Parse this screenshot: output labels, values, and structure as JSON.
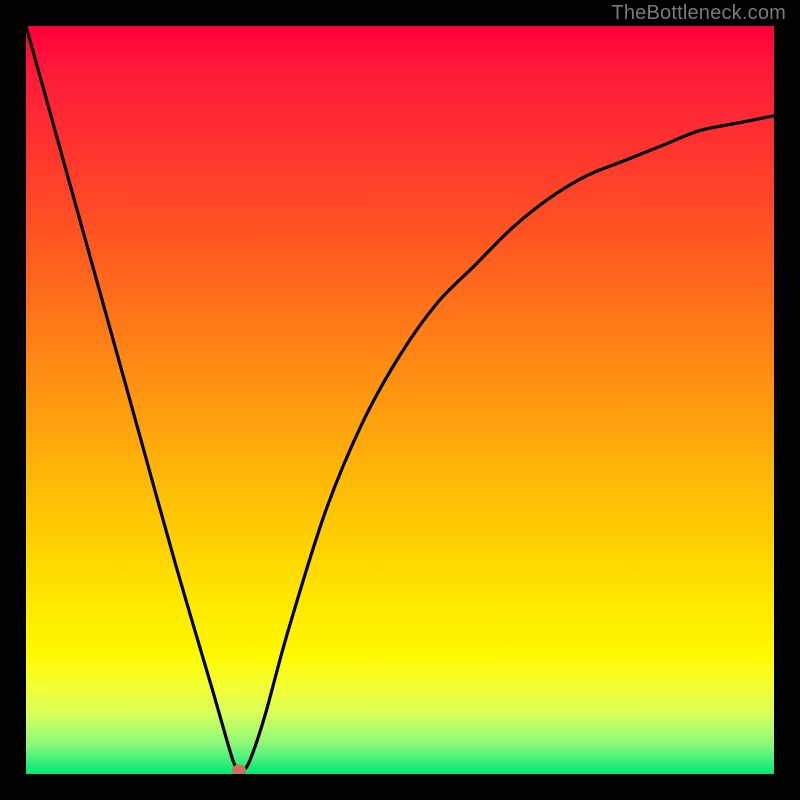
{
  "watermark": "TheBottleneck.com",
  "chart_data": {
    "type": "line",
    "title": "",
    "xlabel": "",
    "ylabel": "",
    "xlim": [
      0,
      100
    ],
    "ylim": [
      0,
      100
    ],
    "grid": false,
    "legend": false,
    "series": [
      {
        "name": "bottleneck-curve",
        "x": [
          0,
          5,
          10,
          15,
          20,
          25,
          27,
          28,
          29,
          30,
          32,
          35,
          40,
          45,
          50,
          55,
          60,
          65,
          70,
          75,
          80,
          85,
          90,
          95,
          100
        ],
        "y": [
          100,
          82,
          64,
          46,
          28,
          11,
          4,
          1,
          0.5,
          2,
          8,
          19,
          35,
          47,
          56,
          63,
          68,
          73,
          77,
          80,
          82,
          84,
          86,
          87,
          88
        ]
      }
    ],
    "annotations": [
      {
        "name": "optimal-point",
        "type": "marker",
        "x": 28.5,
        "y": 0.5,
        "color": "#d86a5a"
      }
    ],
    "background": {
      "type": "vertical-gradient",
      "stops": [
        {
          "pos": 0.0,
          "color": "#ff003a"
        },
        {
          "pos": 0.5,
          "color": "#ff9810"
        },
        {
          "pos": 0.84,
          "color": "#fff800"
        },
        {
          "pos": 1.0,
          "color": "#00e878"
        }
      ]
    }
  }
}
